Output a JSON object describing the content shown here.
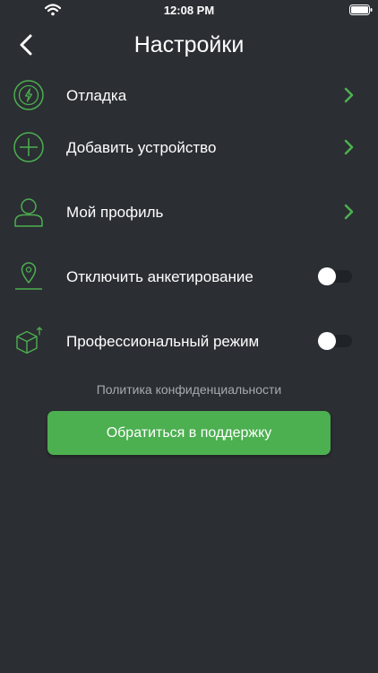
{
  "status_bar": {
    "time": "12:08 PM"
  },
  "header": {
    "title": "Настройки",
    "back_icon": "chevron-left-icon"
  },
  "settings": {
    "items": [
      {
        "label": "Отладка",
        "icon": "lightning-circle-icon",
        "control": "chevron"
      },
      {
        "label": "Добавить устройство",
        "icon": "plus-circle-icon",
        "control": "chevron"
      },
      {
        "label": "Мой профиль",
        "icon": "user-icon",
        "control": "chevron"
      },
      {
        "label": "Отключить анкетирование",
        "icon": "map-pin-icon",
        "control": "toggle",
        "on": false
      },
      {
        "label": "Профессиональный режим",
        "icon": "box-upgrade-icon",
        "control": "toggle",
        "on": false
      }
    ]
  },
  "footer": {
    "privacy_link": "Политика конфиденциальности",
    "support_button": "Обратиться в поддержку"
  },
  "colors": {
    "background": "#2b2e33",
    "accent": "#4caf50",
    "muted_text": "#a7abb1"
  }
}
